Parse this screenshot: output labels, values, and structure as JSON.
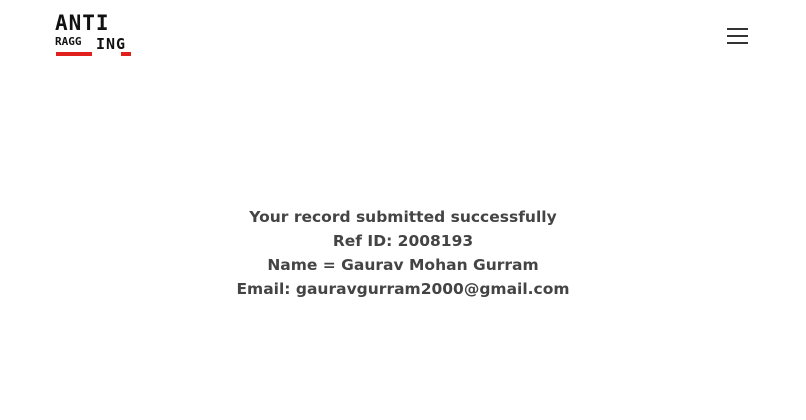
{
  "header": {
    "logo": {
      "top": "ANTI",
      "bottom_left": "RAGG",
      "bottom_right": "ING",
      "accent_color": "#e0201c"
    },
    "menu_icon": "hamburger-menu-icon"
  },
  "confirmation": {
    "status": "Your record submitted successfully",
    "ref_id": "Ref ID: 2008193",
    "name": "Name = Gaurav Mohan Gurram",
    "email": "Email: gauravgurram2000@gmail.com"
  }
}
